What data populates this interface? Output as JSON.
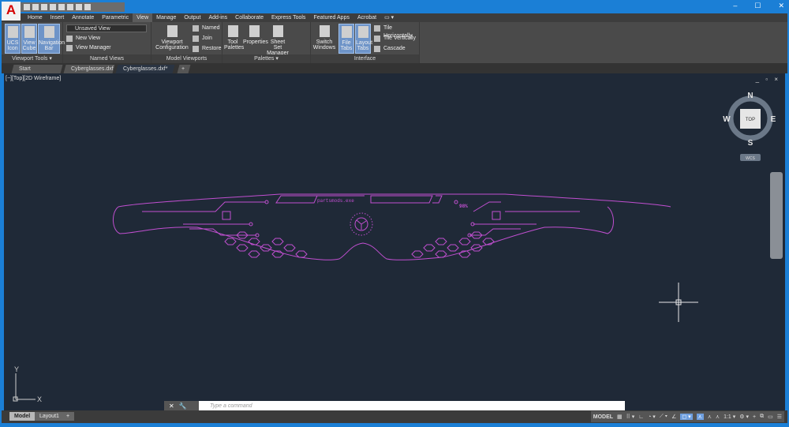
{
  "app": {
    "logo": "A"
  },
  "window": {
    "minimize": "–",
    "maximize": "☐",
    "close": "✕"
  },
  "ribbon_tabs": [
    "Home",
    "Insert",
    "Annotate",
    "Parametric",
    "View",
    "Manage",
    "Output",
    "Add-ins",
    "Collaborate",
    "Express Tools",
    "Featured Apps",
    "Acrobat",
    "▭ ▾"
  ],
  "active_tab": "View",
  "panels": {
    "viewport_tools": {
      "title": "Viewport Tools ▾",
      "buttons": [
        "UCS Icon",
        "View Cube",
        "Navigation Bar"
      ]
    },
    "named_views": {
      "title": "Named Views",
      "dropdown": "Unsaved View",
      "items": [
        "New View",
        "View Manager"
      ]
    },
    "model_viewports": {
      "title": "Model Viewports",
      "big": "Viewport Configuration",
      "items": [
        "Named",
        "Join",
        "Restore"
      ]
    },
    "palettes": {
      "title": "Palettes ▾",
      "buttons": [
        "Tool Palettes",
        "Properties",
        "Sheet Set Manager"
      ]
    },
    "interface": {
      "title": "Interface",
      "buttons": [
        "Switch Windows",
        "File Tabs",
        "Layout Tabs"
      ],
      "items": [
        "Tile Horizontally",
        "Tile Vertically",
        "Cascade"
      ]
    }
  },
  "file_tabs": [
    {
      "label": "Start"
    },
    {
      "label": "Cyberglasses.dxf",
      "close": "✕"
    },
    {
      "label": "Cyberglasses.dxf*",
      "close": "✕"
    },
    {
      "label": "+"
    }
  ],
  "viewport": {
    "label": "[−][Top][2D Wireframe]",
    "controls": "_ ▫ ×",
    "drawing_text": "partsmods.exe",
    "percent": "98%",
    "compass": {
      "n": "N",
      "s": "S",
      "e": "E",
      "w": "W",
      "face": "TOP",
      "wcs": "WCS"
    },
    "ucs": {
      "x": "X",
      "y": "Y"
    },
    "colors": {
      "background": "#1f2937",
      "drawing": "#c04fd0"
    }
  },
  "layout_tabs": [
    "Model",
    "Layout1",
    "+"
  ],
  "command": {
    "placeholder": "Type a command",
    "buttons": [
      "✕",
      "🔧"
    ]
  },
  "status": {
    "model": "MODEL",
    "items": [
      "▦",
      "⠿ ▾",
      "∟",
      "◔ ▾",
      "⟋ ▾",
      "∠",
      "◻ ▾",
      "⋏",
      "⋏",
      "⋏",
      "1:1 ▾",
      "⚙ ▾",
      "+",
      "⧉",
      "▭",
      "☰"
    ]
  }
}
